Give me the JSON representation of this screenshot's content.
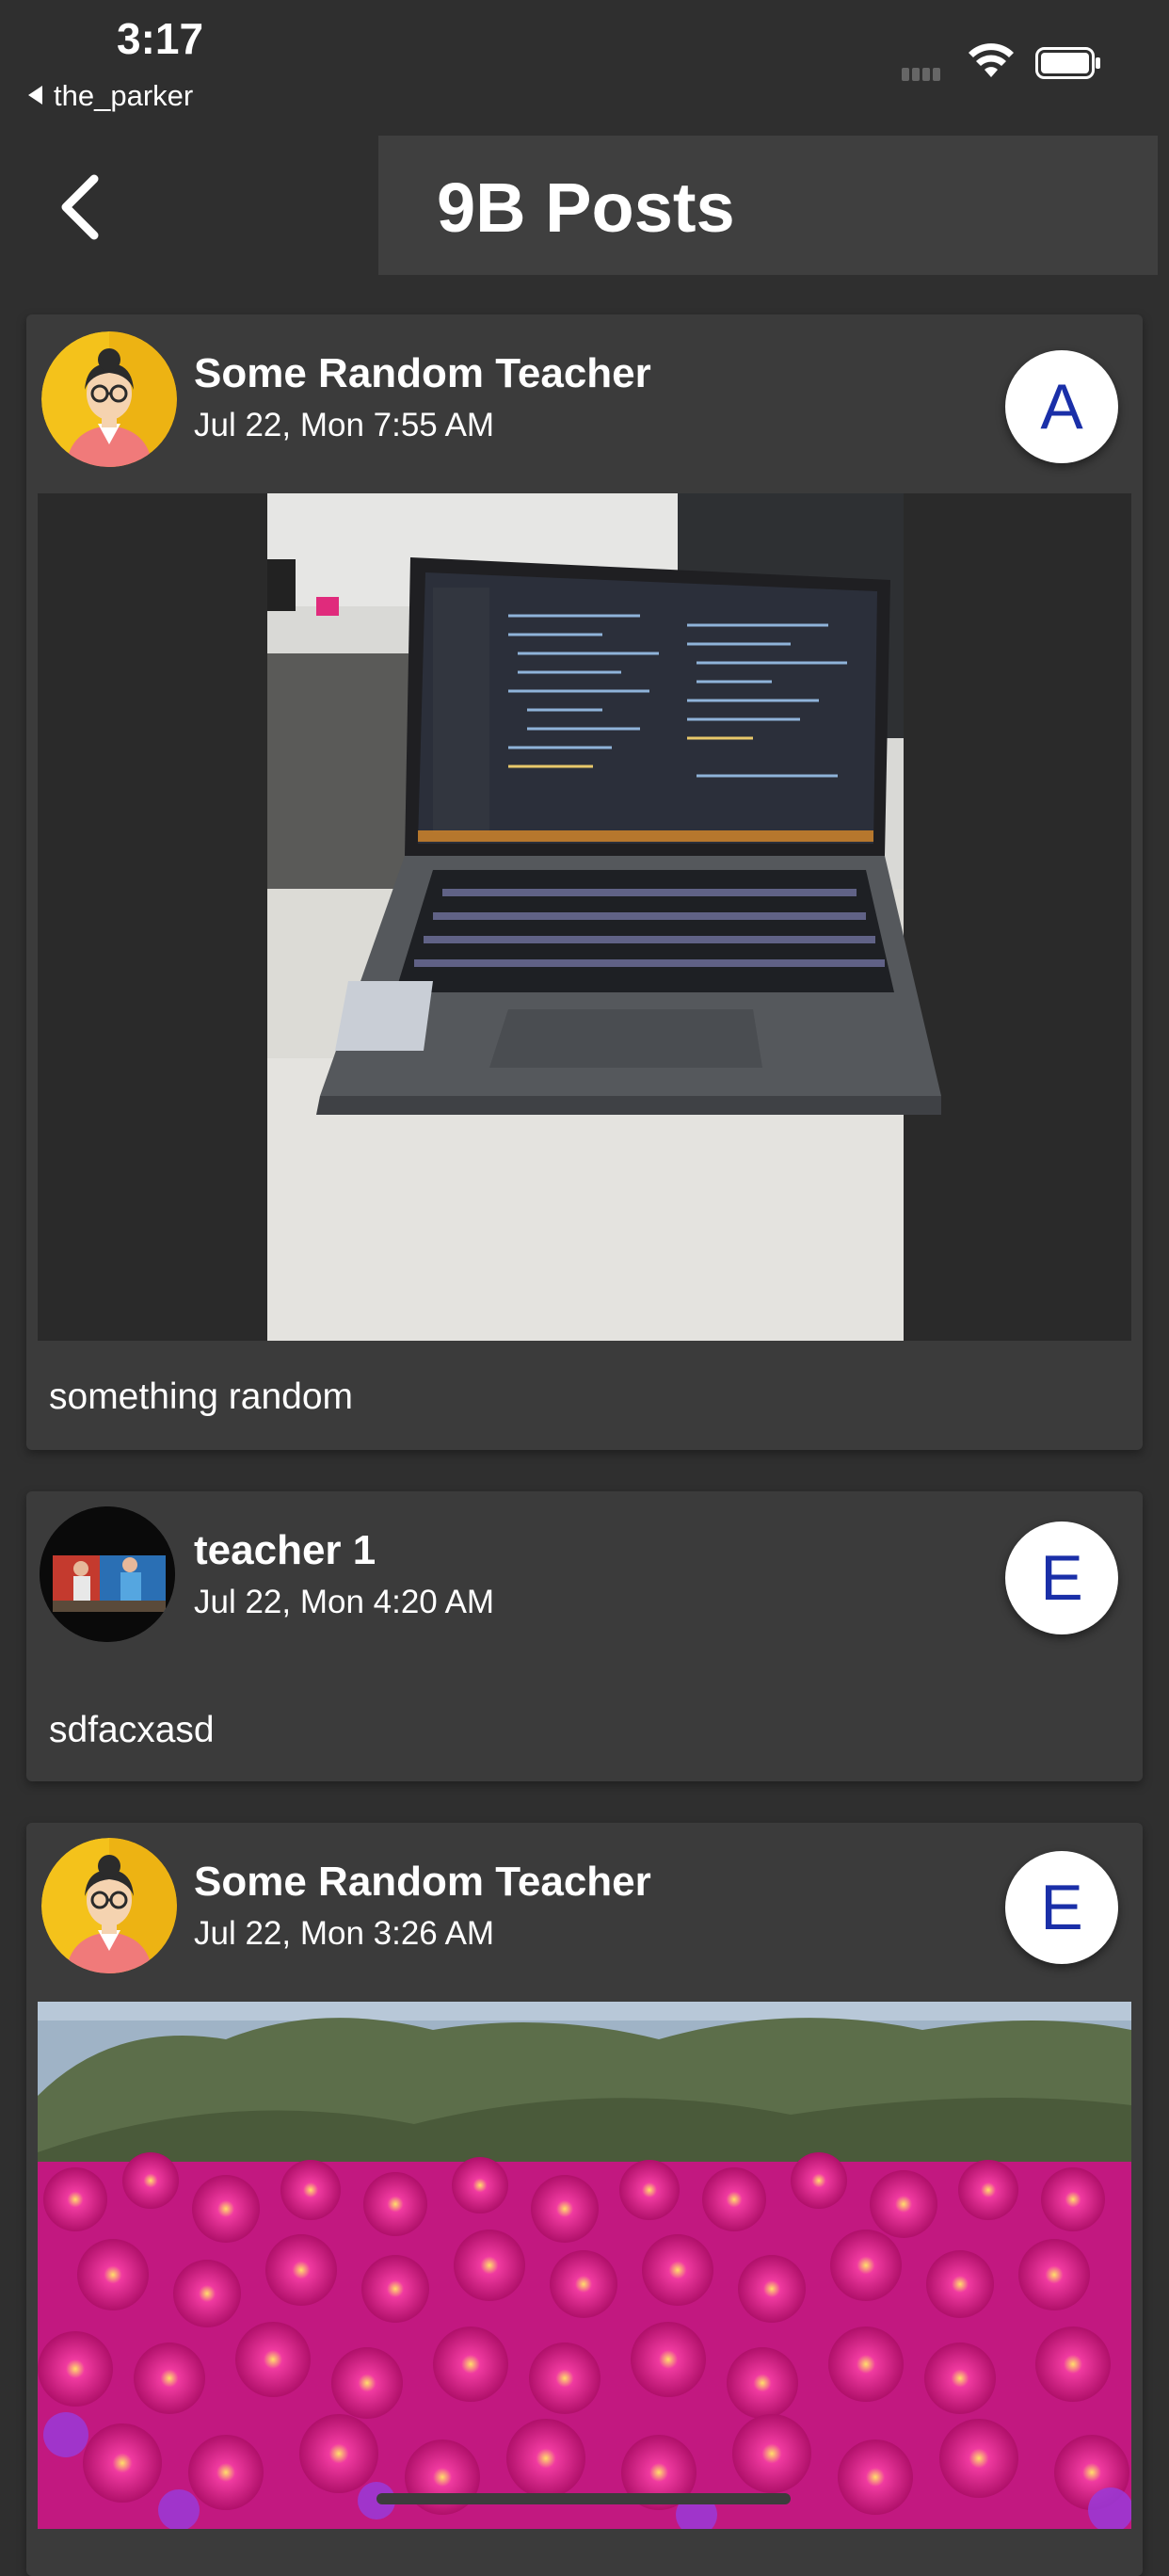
{
  "status_bar": {
    "time": "3:17",
    "back_app": "the_parker"
  },
  "header": {
    "title": "9B Posts"
  },
  "posts": [
    {
      "author": "Some Random Teacher",
      "date": "Jul 22, Mon 7:55 AM",
      "badge": "A",
      "caption": "something random",
      "avatar_icon": "teacher-avatar-icon",
      "image": "laptop-photo"
    },
    {
      "author": "teacher 1",
      "date": "Jul 22, Mon 4:20 AM",
      "badge": "E",
      "caption": "sdfacxasd",
      "avatar_icon": "photo-avatar",
      "image": null
    },
    {
      "author": "Some Random Teacher",
      "date": "Jul 22, Mon 3:26 AM",
      "badge": "E",
      "caption": "",
      "avatar_icon": "teacher-avatar-icon",
      "image": "flowers-photo"
    }
  ],
  "colors": {
    "background": "#2f2f2f",
    "card": "#3b3b3b",
    "header_box": "#3f3f3f",
    "badge_text": "#1a2fa8"
  }
}
